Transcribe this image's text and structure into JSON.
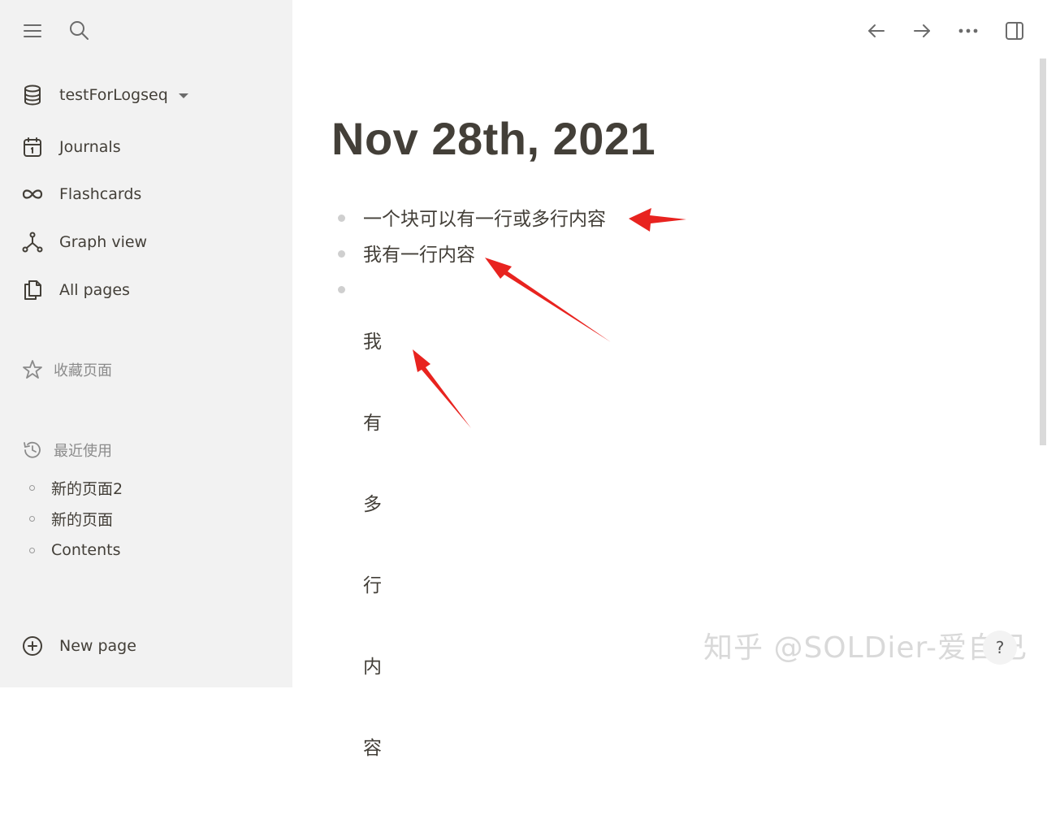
{
  "sidebar": {
    "graph_name": "testForLogseq",
    "nav": [
      {
        "label": "Journals",
        "icon": "calendar-icon"
      },
      {
        "label": "Flashcards",
        "icon": "infinity-icon"
      },
      {
        "label": "Graph view",
        "icon": "graph-icon"
      },
      {
        "label": "All pages",
        "icon": "pages-icon"
      }
    ],
    "favorites_label": "收藏页面",
    "recent_label": "最近使用",
    "recent_items": [
      "新的页面2",
      "新的页面",
      "Contents"
    ],
    "new_page_label": "New page"
  },
  "toolbar": {
    "icons": [
      "menu-icon",
      "search-icon",
      "back-arrow-icon",
      "forward-arrow-icon",
      "more-icon",
      "right-sidebar-icon"
    ]
  },
  "page": {
    "title": "Nov 28th, 2021",
    "blocks": [
      {
        "text": "一个块可以有一行或多行内容"
      },
      {
        "text": "我有一行内容"
      },
      {
        "lines": [
          "我",
          "有",
          "多",
          "行",
          "内",
          "容"
        ]
      }
    ]
  },
  "watermark": "知乎 @SOLDier-爱自己",
  "colors": {
    "sidebar_bg": "#f2f2f2",
    "text": "#433f38",
    "muted": "#8b8b8b",
    "bullet": "#cfcfcf",
    "annotation_arrow": "#e8231f"
  }
}
